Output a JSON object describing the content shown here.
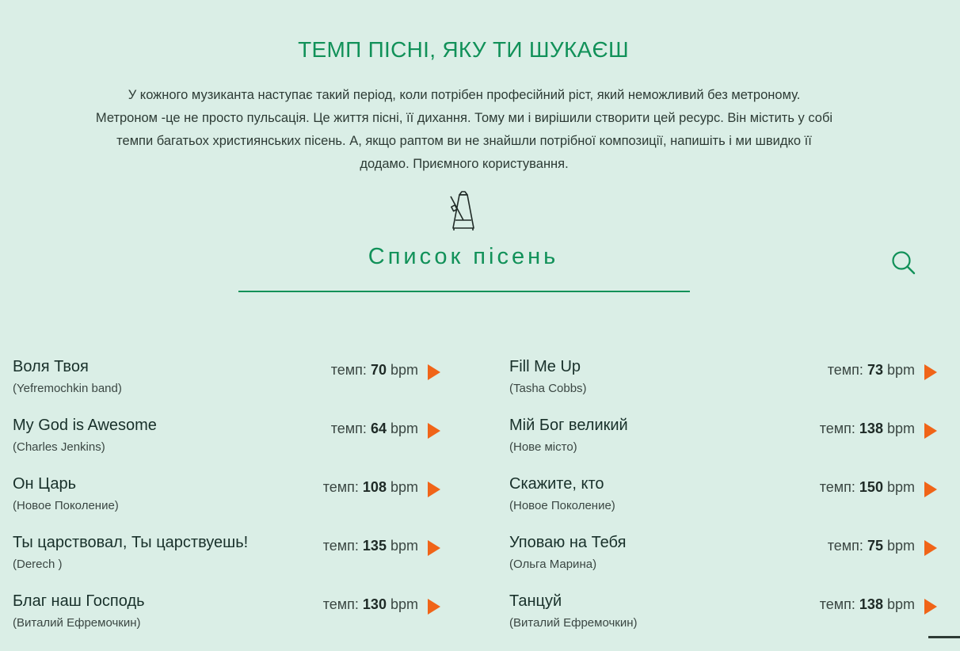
{
  "header": {
    "title": "ТЕМП ПІСНІ, ЯКУ ТИ ШУКАЄШ",
    "intro_lines": [
      "У кожного музиканта наступає такий період, коли потрібен професійний ріст, який неможливий без метроному.",
      "Метроном -це не просто пульсація. Це життя пісні, її дихання. Тому ми і вирішили створити цей ресурс. Він містить у собі",
      "темпи багатьох християнських пісень. А, якщо раптом ви не знайшли потрібної композиції, напишіть і ми швидко її",
      "додамо. Приємного користування."
    ]
  },
  "list": {
    "title": "Список пісень",
    "tempo_prefix": "темп:",
    "unit": "bpm"
  },
  "icons": {
    "metronome": "metronome-icon",
    "search": "search-icon",
    "play": "play-icon"
  },
  "colors": {
    "background": "#daeee6",
    "accent_green": "#119159",
    "play_orange": "#f06418"
  },
  "songs_left": [
    {
      "title": "Воля Твоя",
      "artist": "(Yefremochkin band)",
      "bpm": "70"
    },
    {
      "title": "My God is Awesome",
      "artist": "(Charles Jenkins)",
      "bpm": "64"
    },
    {
      "title": "Он Царь",
      "artist": "(Новое Поколение)",
      "bpm": "108"
    },
    {
      "title": "Ты царствовал, Ты царствуешь!",
      "artist": "(Derech )",
      "bpm": "135"
    },
    {
      "title": "Благ наш Господь",
      "artist": "(Виталий Ефремочкин)",
      "bpm": "130"
    }
  ],
  "songs_right": [
    {
      "title": "Fill Me Up",
      "artist": "(Tasha Cobbs)",
      "bpm": "73"
    },
    {
      "title": "Мій Бог великий",
      "artist": "(Нове місто)",
      "bpm": "138"
    },
    {
      "title": "Скажите, кто",
      "artist": "(Новое Поколение)",
      "bpm": "150"
    },
    {
      "title": "Уповаю на Тебя",
      "artist": "(Ольга Марина)",
      "bpm": "75"
    },
    {
      "title": "Танцуй",
      "artist": "(Виталий Ефремочкин)",
      "bpm": "138"
    }
  ]
}
